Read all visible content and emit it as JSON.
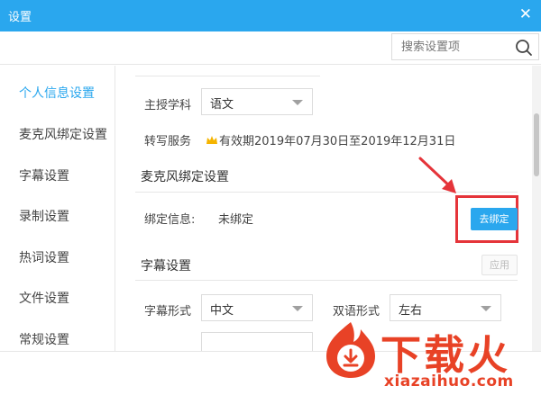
{
  "window": {
    "title": "设置",
    "close_glyph": "✕"
  },
  "search": {
    "placeholder": "搜索设置项",
    "value": ""
  },
  "sidebar": {
    "items": [
      {
        "label": "个人信息设置",
        "active": true
      },
      {
        "label": "麦克风绑定设置",
        "active": false
      },
      {
        "label": "字幕设置",
        "active": false
      },
      {
        "label": "录制设置",
        "active": false
      },
      {
        "label": "热词设置",
        "active": false
      },
      {
        "label": "文件设置",
        "active": false
      },
      {
        "label": "常规设置",
        "active": false
      }
    ]
  },
  "personal": {
    "subject_label": "主授学科",
    "subject_value": "语文",
    "service_label": "转写服务",
    "service_value": "有效期2019年07月30日至2019年12月31日"
  },
  "mic": {
    "section_title": "麦克风绑定设置",
    "bind_label": "绑定信息:",
    "bind_value": "未绑定",
    "bind_button": "去绑定"
  },
  "subtitle": {
    "section_title": "字幕设置",
    "apply_button": "应用",
    "form_label": "字幕形式",
    "form_value": "中文",
    "bilingual_label": "双语形式",
    "bilingual_value": "左右"
  },
  "watermark": {
    "brand": "下载火",
    "domain": "xiazaihuo.com"
  },
  "colors": {
    "accent": "#2aa7ee",
    "highlight": "#e5343a",
    "watermark": "#e84226",
    "crown": "#f5b400"
  },
  "icons": [
    "close-icon",
    "search-icon",
    "caret-down-icon",
    "crown-icon",
    "arrow-icon",
    "download-logo-icon"
  ]
}
